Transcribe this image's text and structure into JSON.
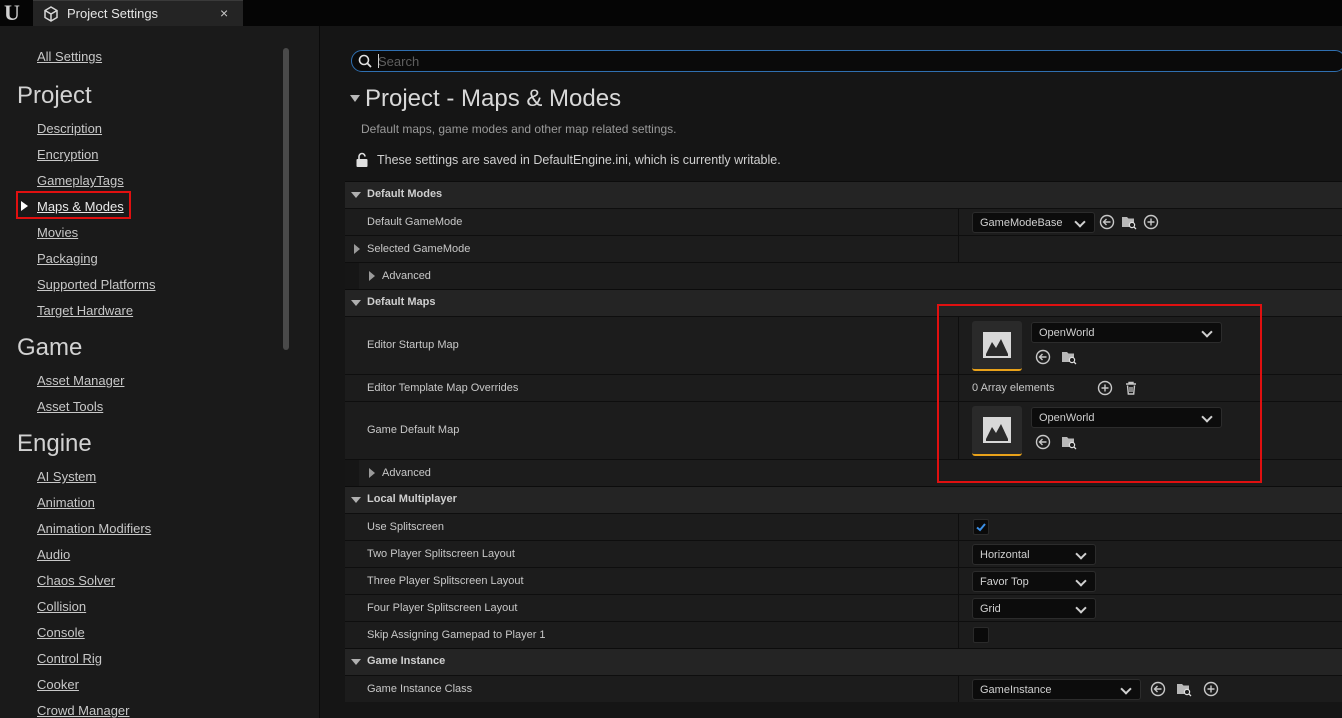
{
  "tab": {
    "title": "Project Settings",
    "close": "×"
  },
  "sidebar": {
    "all_settings": "All Settings",
    "project": {
      "heading": "Project",
      "items": [
        "Description",
        "Encryption",
        "GameplayTags",
        "Maps & Modes",
        "Movies",
        "Packaging",
        "Supported Platforms",
        "Target Hardware"
      ]
    },
    "game": {
      "heading": "Game",
      "items": [
        "Asset Manager",
        "Asset Tools"
      ]
    },
    "engine": {
      "heading": "Engine",
      "items": [
        "AI System",
        "Animation",
        "Animation Modifiers",
        "Audio",
        "Chaos Solver",
        "Collision",
        "Console",
        "Control Rig",
        "Cooker",
        "Crowd Manager"
      ]
    },
    "selected": "Maps & Modes"
  },
  "search": {
    "placeholder": "Search",
    "value": ""
  },
  "page": {
    "title": "Project - Maps & Modes",
    "description": "Default maps, game modes and other map related settings.",
    "save_note": "These settings are saved in DefaultEngine.ini, which is currently writable."
  },
  "sections": {
    "default_modes": {
      "title": "Default Modes",
      "default_gamemode_label": "Default GameMode",
      "default_gamemode_value": "GameModeBase",
      "selected_gamemode_label": "Selected GameMode",
      "advanced_label": "Advanced"
    },
    "default_maps": {
      "title": "Default Maps",
      "editor_startup_label": "Editor Startup Map",
      "editor_startup_value": "OpenWorld",
      "template_overrides_label": "Editor Template Map Overrides",
      "template_overrides_value": "0 Array elements",
      "game_default_label": "Game Default Map",
      "game_default_value": "OpenWorld",
      "advanced_label": "Advanced"
    },
    "local_multiplayer": {
      "title": "Local Multiplayer",
      "use_splitscreen_label": "Use Splitscreen",
      "use_splitscreen_checked": true,
      "two_player_label": "Two Player Splitscreen Layout",
      "two_player_value": "Horizontal",
      "three_player_label": "Three Player Splitscreen Layout",
      "three_player_value": "Favor Top",
      "four_player_label": "Four Player Splitscreen Layout",
      "four_player_value": "Grid",
      "skip_gamepad_label": "Skip Assigning Gamepad to Player 1",
      "skip_gamepad_checked": false
    },
    "game_instance": {
      "title": "Game Instance",
      "class_label": "Game Instance Class",
      "class_value": "GameInstance"
    }
  },
  "colors": {
    "highlight": "#e01010",
    "accent": "#2f6fb0",
    "thumb_underline": "#e9a21a"
  }
}
